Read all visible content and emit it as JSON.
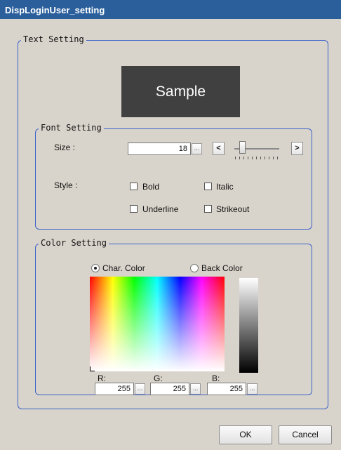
{
  "window": {
    "title": "DispLoginUser_setting"
  },
  "text_setting": {
    "legend": "Text Setting",
    "sample_text": "Sample"
  },
  "font_setting": {
    "legend": "Font Setting",
    "size_label": "Size :",
    "size_value": "18",
    "size_browse": "...",
    "decrease_label": "<",
    "increase_label": ">",
    "style_label": "Style :",
    "options": {
      "bold": "Bold",
      "italic": "Italic",
      "underline": "Underline",
      "strikeout": "Strikeout"
    }
  },
  "color_setting": {
    "legend": "Color Setting",
    "char_color_label": "Char. Color",
    "back_color_label": "Back Color",
    "selected": "char",
    "r_label": "R:",
    "g_label": "G:",
    "b_label": "B:",
    "r_value": "255",
    "g_value": "255",
    "b_value": "255",
    "browse": "..."
  },
  "buttons": {
    "ok": "OK",
    "cancel": "Cancel"
  },
  "colors": {
    "title_bar": "#2a5f9c",
    "group_border": "#3a62c9",
    "window_bg": "#d9d4cb",
    "sample_bg": "#404040"
  }
}
